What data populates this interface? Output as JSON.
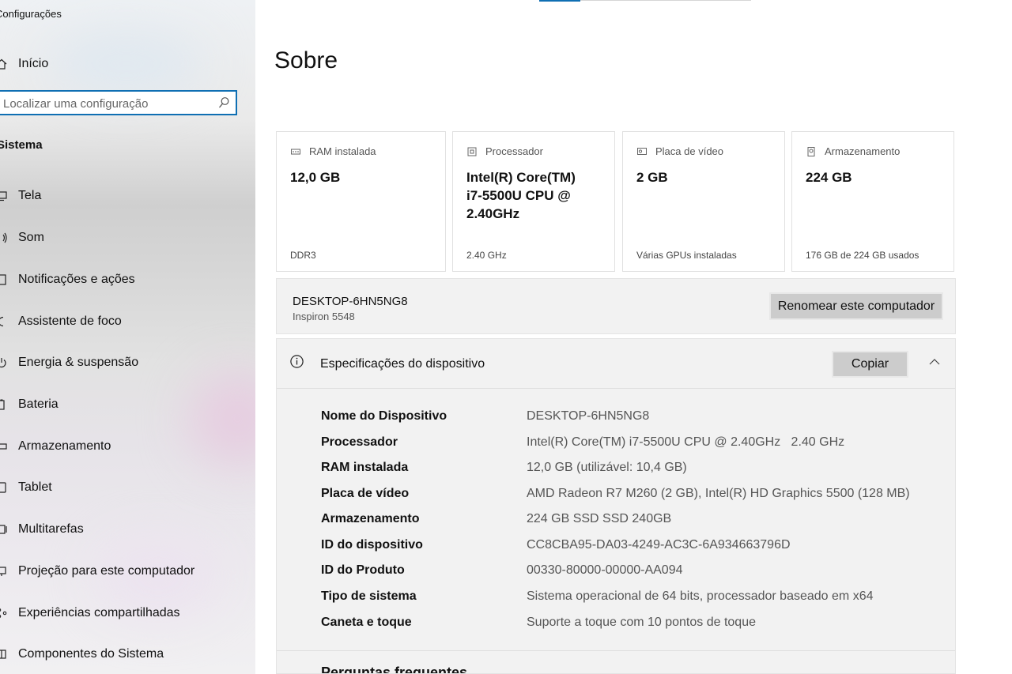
{
  "sidebar": {
    "app_title": "Configurações",
    "home_label": "Início",
    "search_placeholder": "Localizar uma configuração",
    "section_title": "Sistema",
    "items": [
      {
        "label": "Tela",
        "icon": "monitor-icon"
      },
      {
        "label": "Som",
        "icon": "speaker-icon"
      },
      {
        "label": "Notificações e ações",
        "icon": "notification-icon"
      },
      {
        "label": "Assistente de foco",
        "icon": "moon-icon"
      },
      {
        "label": "Energia & suspensão",
        "icon": "power-icon"
      },
      {
        "label": "Bateria",
        "icon": "battery-icon"
      },
      {
        "label": "Armazenamento",
        "icon": "storage-icon"
      },
      {
        "label": "Tablet",
        "icon": "tablet-icon"
      },
      {
        "label": "Multitarefas",
        "icon": "multitask-icon"
      },
      {
        "label": "Projeção para este computador",
        "icon": "projection-icon"
      },
      {
        "label": "Experiências compartilhadas",
        "icon": "share-icon"
      },
      {
        "label": "Componentes do Sistema",
        "icon": "components-icon"
      }
    ]
  },
  "main": {
    "title": "Sobre",
    "cards": [
      {
        "title": "RAM instalada",
        "value": "12,0 GB",
        "sub": "DDR3",
        "icon": "ram-icon"
      },
      {
        "title": "Processador",
        "value": "Intel(R) Core(TM) i7-5500U CPU @ 2.40GHz",
        "sub": "2.40 GHz",
        "icon": "cpu-icon"
      },
      {
        "title": "Placa de vídeo",
        "value": "2 GB",
        "sub": "Várias GPUs instaladas",
        "icon": "gpu-icon"
      },
      {
        "title": "Armazenamento",
        "value": "224 GB",
        "sub": "176 GB de 224 GB usados",
        "icon": "storage-icon"
      }
    ],
    "device": {
      "name": "DESKTOP-6HN5NG8",
      "model": "Inspiron 5548",
      "rename_label": "Renomear este computador"
    },
    "specs": {
      "header": "Especificações do dispositivo",
      "copy_label": "Copiar",
      "rows": [
        {
          "key": "Nome do Dispositivo",
          "value": "DESKTOP-6HN5NG8"
        },
        {
          "key": "Processador",
          "value": "Intel(R) Core(TM) i7-5500U CPU @ 2.40GHz   2.40 GHz"
        },
        {
          "key": "RAM instalada",
          "value": "12,0 GB (utilizável: 10,4 GB)"
        },
        {
          "key": "Placa de vídeo",
          "value": "AMD Radeon R7 M260 (2 GB), Intel(R) HD Graphics 5500 (128 MB)"
        },
        {
          "key": "Armazenamento",
          "value": "224 GB SSD SSD 240GB"
        },
        {
          "key": "ID do dispositivo",
          "value": "CC8CBA95-DA03-4249-AC3C-6A934663796D"
        },
        {
          "key": "ID do Produto",
          "value": "00330-80000-00000-AA094"
        },
        {
          "key": "Tipo de sistema",
          "value": "Sistema operacional de 64 bits, processador baseado em x64"
        },
        {
          "key": "Caneta e toque",
          "value": "Suporte a toque com 10 pontos de toque"
        }
      ],
      "faq_label": "Perguntas frequentes"
    }
  },
  "colors": {
    "accent": "#0f6fb3",
    "button": "#cccccc",
    "panel": "#f2f2f2"
  }
}
